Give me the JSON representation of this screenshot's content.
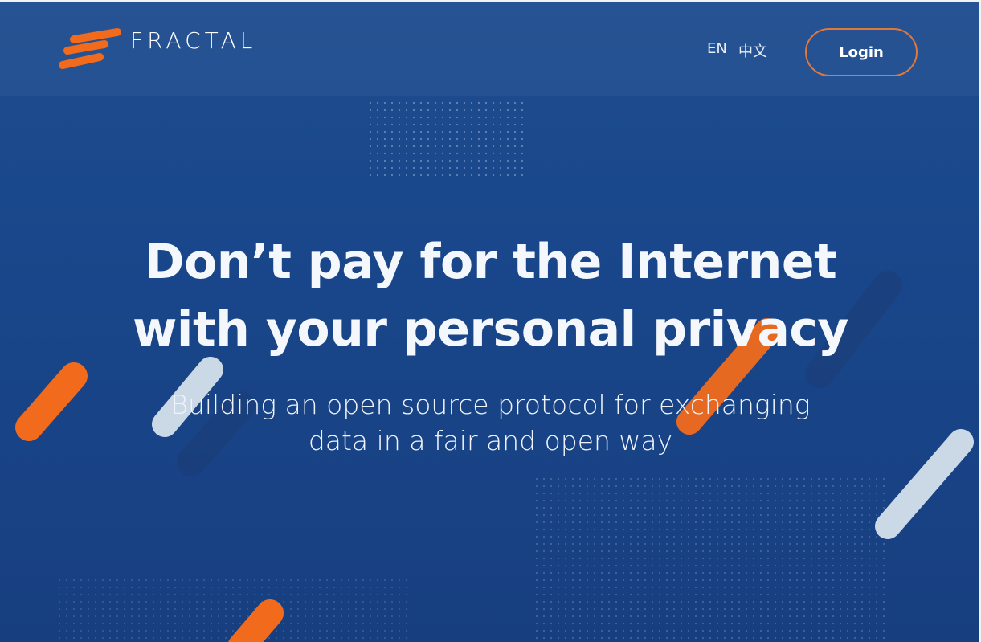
{
  "brand": {
    "name": "FRACTAL",
    "logo_icon": "fractal-logo-icon",
    "accent_color": "#f26b1d"
  },
  "nav": {
    "lang_en": "EN",
    "lang_zh": "中文",
    "login_label": "Login"
  },
  "hero": {
    "title_line1": "Don’t pay for the Internet",
    "title_line2": "with your personal privacy",
    "subtitle_line1": "Building an open source protocol for exchanging",
    "subtitle_line2": "data in a fair and open way"
  },
  "colors": {
    "background": "#1b4a8a",
    "orange": "#f26b1d",
    "light_stroke": "#cbd8e6",
    "login_border": "#e2773a"
  }
}
